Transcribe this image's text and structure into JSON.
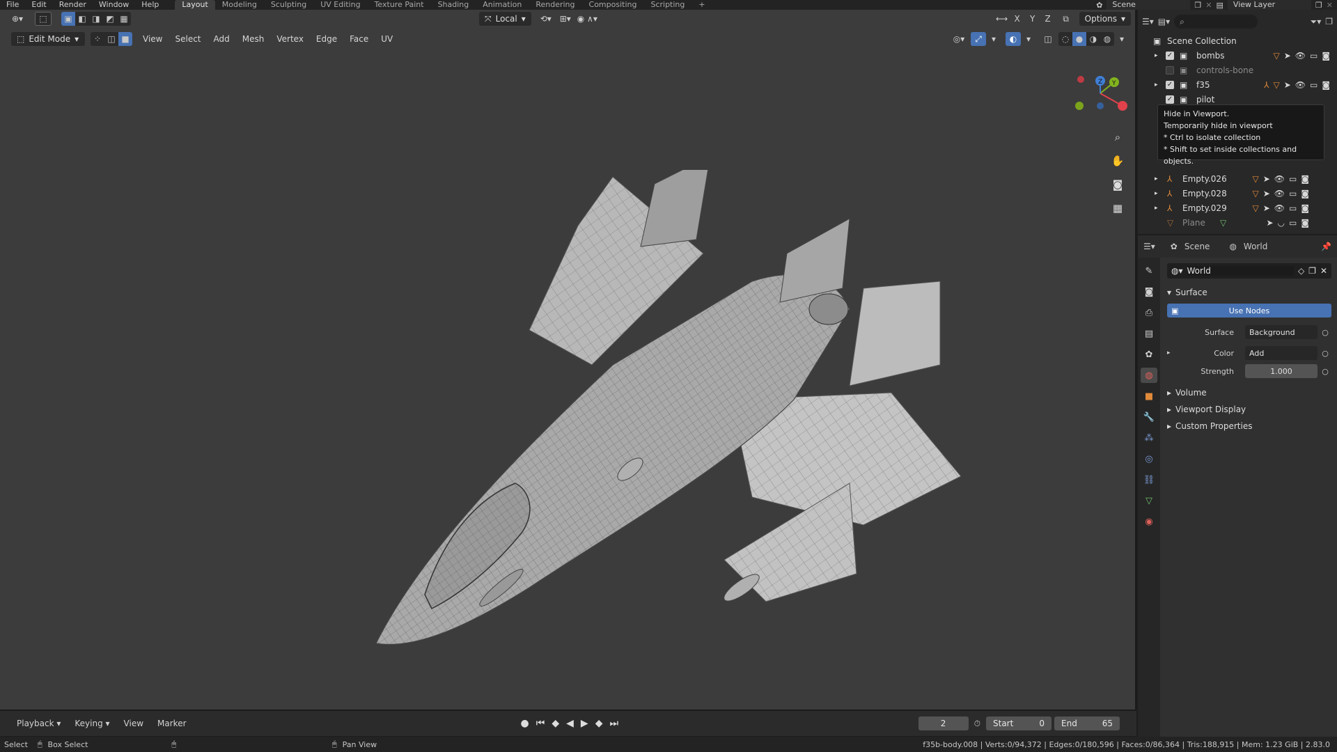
{
  "menu": [
    "File",
    "Edit",
    "Render",
    "Window",
    "Help"
  ],
  "workspaces": [
    "Layout",
    "Modeling",
    "Sculpting",
    "UV Editing",
    "Texture Paint",
    "Shading",
    "Animation",
    "Rendering",
    "Compositing",
    "Scripting",
    "+"
  ],
  "active_workspace": "Layout",
  "scene_name": "Scene",
  "view_layer": "View Layer",
  "viewport": {
    "transform_orientation": "Local",
    "axes": [
      "X",
      "Y",
      "Z"
    ],
    "options_label": "Options",
    "mode": "Edit Mode",
    "menus": [
      "View",
      "Select",
      "Add",
      "Mesh",
      "Vertex",
      "Edge",
      "Face",
      "UV"
    ],
    "gizmo_labels": {
      "x": "",
      "y": "Y",
      "z": "Z"
    }
  },
  "outliner": {
    "root": "Scene Collection",
    "rows": [
      {
        "name": "bombs",
        "dim": false
      },
      {
        "name": "controls-bone",
        "dim": true
      },
      {
        "name": "f35",
        "dim": false
      },
      {
        "name": "pilot",
        "dim": false
      },
      {
        "name": "Empty.026",
        "dim": false
      },
      {
        "name": "Empty.028",
        "dim": false
      },
      {
        "name": "Empty.029",
        "dim": false
      },
      {
        "name": "Plane",
        "dim": true
      }
    ],
    "tooltip": {
      "title": "Hide in Viewport.",
      "line1": "Temporarily hide in viewport",
      "line2": "* Ctrl to isolate collection",
      "line3": "* Shift to set inside collections and objects."
    }
  },
  "properties": {
    "header_scene": "Scene",
    "header_world": "World",
    "world_name": "World",
    "surface_section": "Surface",
    "use_nodes": "Use Nodes",
    "surface_label": "Surface",
    "surface_value": "Background",
    "color_label": "Color",
    "color_value": "Add",
    "strength_label": "Strength",
    "strength_value": "1.000",
    "collapsed_sections": [
      "Volume",
      "Viewport Display",
      "Custom Properties"
    ]
  },
  "timeline": {
    "menus": [
      "Playback",
      "Keying",
      "View",
      "Marker"
    ],
    "current_frame": "2",
    "start_label": "Start",
    "start_value": "0",
    "end_label": "End",
    "end_value": "65"
  },
  "status": {
    "select": "Select",
    "box_select": "Box Select",
    "pan_view": "Pan View",
    "stats": "f35b-body.008 | Verts:0/94,372 | Edges:0/180,596 | Faces:0/86,364 | Tris:188,915 | Mem: 1.23 GiB | 2.83.0"
  }
}
